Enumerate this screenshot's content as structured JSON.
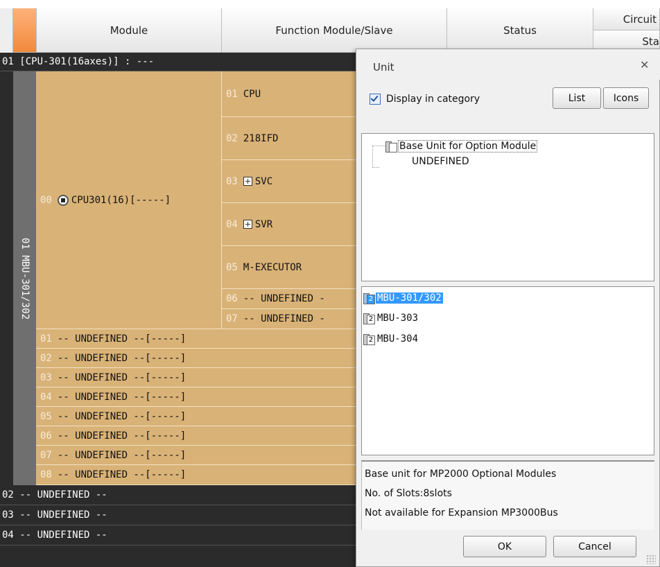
{
  "header": {
    "module": "Module",
    "function_module": "Function Module/Slave",
    "status": "Status",
    "circuit": "Circuit",
    "sta": "Sta"
  },
  "tree": {
    "group_title": "01 [CPU-301(16axes)] : ---",
    "base_unit_vertical": "01 MBU-301/302",
    "cpu_slot_num": "00",
    "cpu_name": "CPU301(16)[-----]",
    "functions": [
      {
        "num": "01",
        "name": "CPU",
        "expand": false
      },
      {
        "num": "02",
        "name": "218IFD",
        "expand": false
      },
      {
        "num": "03",
        "name": "SVC",
        "expand": true
      },
      {
        "num": "04",
        "name": "SVR",
        "expand": true
      },
      {
        "num": "05",
        "name": "M-EXECUTOR",
        "expand": false
      },
      {
        "num": "06",
        "name": "-- UNDEFINED -",
        "expand": false
      },
      {
        "num": "07",
        "name": "-- UNDEFINED -",
        "expand": false
      }
    ],
    "slots": [
      {
        "num": "01",
        "name": "-- UNDEFINED --[-----]"
      },
      {
        "num": "02",
        "name": "-- UNDEFINED --[-----]"
      },
      {
        "num": "03",
        "name": "-- UNDEFINED --[-----]"
      },
      {
        "num": "04",
        "name": "-- UNDEFINED --[-----]"
      },
      {
        "num": "05",
        "name": "-- UNDEFINED --[-----]"
      },
      {
        "num": "06",
        "name": "-- UNDEFINED --[-----]"
      },
      {
        "num": "07",
        "name": "-- UNDEFINED --[-----]"
      },
      {
        "num": "08",
        "name": "-- UNDEFINED --[-----]"
      }
    ],
    "other_groups": [
      "02 -- UNDEFINED --",
      "03 -- UNDEFINED --",
      "04 -- UNDEFINED --"
    ]
  },
  "dialog": {
    "title": "Unit",
    "close_icon": "close-icon",
    "display_in_category": "Display in category",
    "display_in_category_checked": true,
    "list_button": "List",
    "icons_button": "Icons",
    "category_line1": "Base Unit for Option Module",
    "category_line2": "UNDEFINED",
    "units": [
      {
        "badge": "2",
        "label": "MBU-301/302",
        "selected": true
      },
      {
        "badge": "2",
        "label": "MBU-303",
        "selected": false
      },
      {
        "badge": "2",
        "label": "MBU-304",
        "selected": false
      }
    ],
    "description": [
      "Base unit for MP2000 Optional Modules",
      "No. of Slots:8slots",
      "Not available for Expansion MP3000Bus"
    ],
    "ok": "OK",
    "cancel": "Cancel"
  },
  "colors": {
    "tan": "#d9b277",
    "dark_row": "#2b2b2b",
    "header_orange": "#f08a3c",
    "selection": "#3399ff"
  }
}
